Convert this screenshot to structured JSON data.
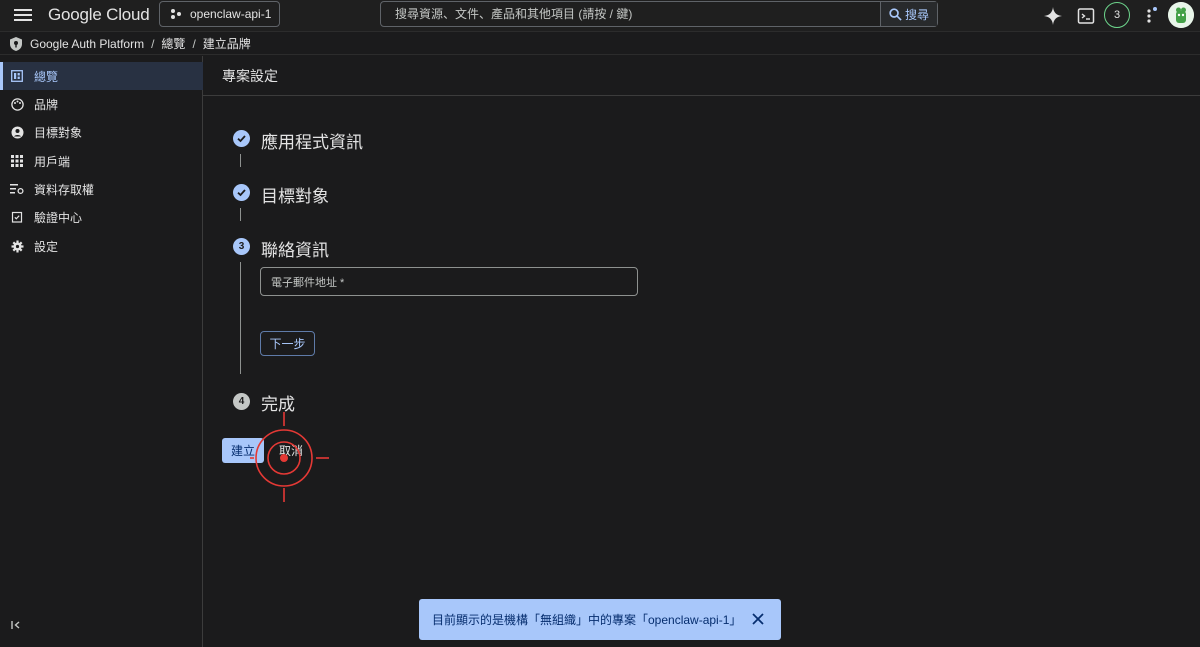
{
  "header": {
    "app_name": "Google Cloud",
    "project": "openclaw-api-1",
    "search_placeholder": "搜尋資源、文件、產品和其他項目 (請按 / 鍵)",
    "search_button": "搜尋",
    "notification_count": "3"
  },
  "breadcrumb": {
    "items": [
      "Google Auth Platform",
      "總覽",
      "建立品牌"
    ]
  },
  "sidebar": {
    "items": [
      {
        "label": "總覽",
        "icon": "dashboard-icon",
        "active": true
      },
      {
        "label": "品牌",
        "icon": "palette-icon",
        "active": false
      },
      {
        "label": "目標對象",
        "icon": "person-icon",
        "active": false
      },
      {
        "label": "用戶端",
        "icon": "apps-grid-icon",
        "active": false
      },
      {
        "label": "資料存取權",
        "icon": "data-access-icon",
        "active": false
      },
      {
        "label": "驗證中心",
        "icon": "verification-icon",
        "active": false
      },
      {
        "label": "設定",
        "icon": "settings-gear-icon",
        "active": false
      }
    ]
  },
  "page": {
    "title": "專案設定"
  },
  "stepper": {
    "steps": [
      {
        "number": "1",
        "label": "應用程式資訊",
        "status": "done"
      },
      {
        "number": "2",
        "label": "目標對象",
        "status": "done"
      },
      {
        "number": "3",
        "label": "聯絡資訊",
        "status": "current"
      },
      {
        "number": "4",
        "label": "完成",
        "status": "pending"
      }
    ],
    "email_placeholder": "電子郵件地址 *",
    "next_button": "下一步"
  },
  "actions": {
    "create": "建立",
    "cancel": "取消"
  },
  "toast": {
    "message": "目前顯示的是機構「無組織」中的專案「openclaw-api-1」"
  },
  "colors": {
    "accent": "#a8c7fa",
    "background": "#1b1b1c",
    "cursor_marker": "#e53935"
  }
}
